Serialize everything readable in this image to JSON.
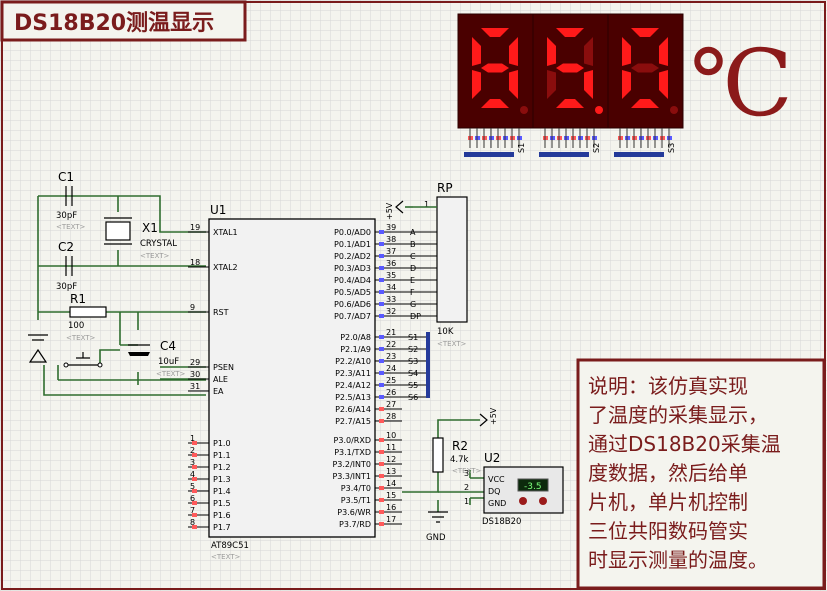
{
  "title": "DS18B20测温显示",
  "display": {
    "digits": [
      "8",
      "5",
      "0"
    ],
    "unit": "℃",
    "labels": [
      "S1",
      "S2",
      "S3"
    ]
  },
  "mcu": {
    "ref": "U1",
    "name": "AT89C51",
    "text": "<TEXT>",
    "left_pins": [
      {
        "num": "19",
        "name": "XTAL1"
      },
      {
        "num": "18",
        "name": "XTAL2"
      },
      {
        "num": "9",
        "name": "RST"
      },
      {
        "num": "29",
        "name": "PSEN"
      },
      {
        "num": "30",
        "name": "ALE"
      },
      {
        "num": "31",
        "name": "EA"
      },
      {
        "num": "1",
        "name": "P1.0"
      },
      {
        "num": "2",
        "name": "P1.1"
      },
      {
        "num": "3",
        "name": "P1.2"
      },
      {
        "num": "4",
        "name": "P1.3"
      },
      {
        "num": "5",
        "name": "P1.4"
      },
      {
        "num": "6",
        "name": "P1.5"
      },
      {
        "num": "7",
        "name": "P1.6"
      },
      {
        "num": "8",
        "name": "P1.7"
      }
    ],
    "right_pins": [
      {
        "num": "39",
        "name": "P0.0/AD0"
      },
      {
        "num": "38",
        "name": "P0.1/AD1"
      },
      {
        "num": "37",
        "name": "P0.2/AD2"
      },
      {
        "num": "36",
        "name": "P0.3/AD3"
      },
      {
        "num": "35",
        "name": "P0.4/AD4"
      },
      {
        "num": "34",
        "name": "P0.5/AD5"
      },
      {
        "num": "33",
        "name": "P0.6/AD6"
      },
      {
        "num": "32",
        "name": "P0.7/AD7"
      },
      {
        "num": "21",
        "name": "P2.0/A8"
      },
      {
        "num": "22",
        "name": "P2.1/A9"
      },
      {
        "num": "23",
        "name": "P2.2/A10"
      },
      {
        "num": "24",
        "name": "P2.3/A11"
      },
      {
        "num": "25",
        "name": "P2.4/A12"
      },
      {
        "num": "26",
        "name": "P2.5/A13"
      },
      {
        "num": "27",
        "name": "P2.6/A14"
      },
      {
        "num": "28",
        "name": "P2.7/A15"
      },
      {
        "num": "10",
        "name": "P3.0/RXD"
      },
      {
        "num": "11",
        "name": "P3.1/TXD"
      },
      {
        "num": "12",
        "name": "P3.2/INT0"
      },
      {
        "num": "13",
        "name": "P3.3/INT1"
      },
      {
        "num": "14",
        "name": "P3.4/T0"
      },
      {
        "num": "15",
        "name": "P3.5/T1"
      },
      {
        "num": "16",
        "name": "P3.6/WR"
      },
      {
        "num": "17",
        "name": "P3.7/RD"
      }
    ],
    "net_labels_p0": [
      "A",
      "B",
      "C",
      "D",
      "E",
      "F",
      "G",
      "DP"
    ],
    "net_labels_p2": [
      "S1",
      "S2",
      "S3",
      "S4",
      "S5",
      "S6"
    ]
  },
  "components": {
    "c1": {
      "ref": "C1",
      "value": "30pF",
      "text": "<TEXT>"
    },
    "c2": {
      "ref": "C2",
      "value": "30pF",
      "text": "<TEXT>"
    },
    "x1": {
      "ref": "X1",
      "value": "CRYSTAL",
      "text": "<TEXT>"
    },
    "r1": {
      "ref": "R1",
      "value": "100",
      "text": "<TEXT>"
    },
    "c4": {
      "ref": "C4",
      "value": "10uF",
      "text": "<TEXT>"
    },
    "rp": {
      "ref": "RP",
      "value": "10K",
      "text": "<TEXT>",
      "pin1": "1"
    },
    "r2": {
      "ref": "R2",
      "value": "4.7k",
      "text": "<TEXT>"
    },
    "u2": {
      "ref": "U2",
      "name": "DS18B20",
      "reading": "-3.5",
      "pins": [
        "VCC",
        "DQ",
        "GND"
      ],
      "pin_nums": [
        "3",
        "2",
        "1"
      ]
    },
    "vcc_label": "+5V",
    "gnd_label": "GND"
  },
  "note": {
    "lines": [
      "说明：该仿真实现",
      "了温度的采集显示，",
      "通过DS18B20采集温",
      "度数据，然后给单",
      "片机，单片机控制",
      "三位共阳数码管实",
      "时显示测量的温度。"
    ]
  }
}
